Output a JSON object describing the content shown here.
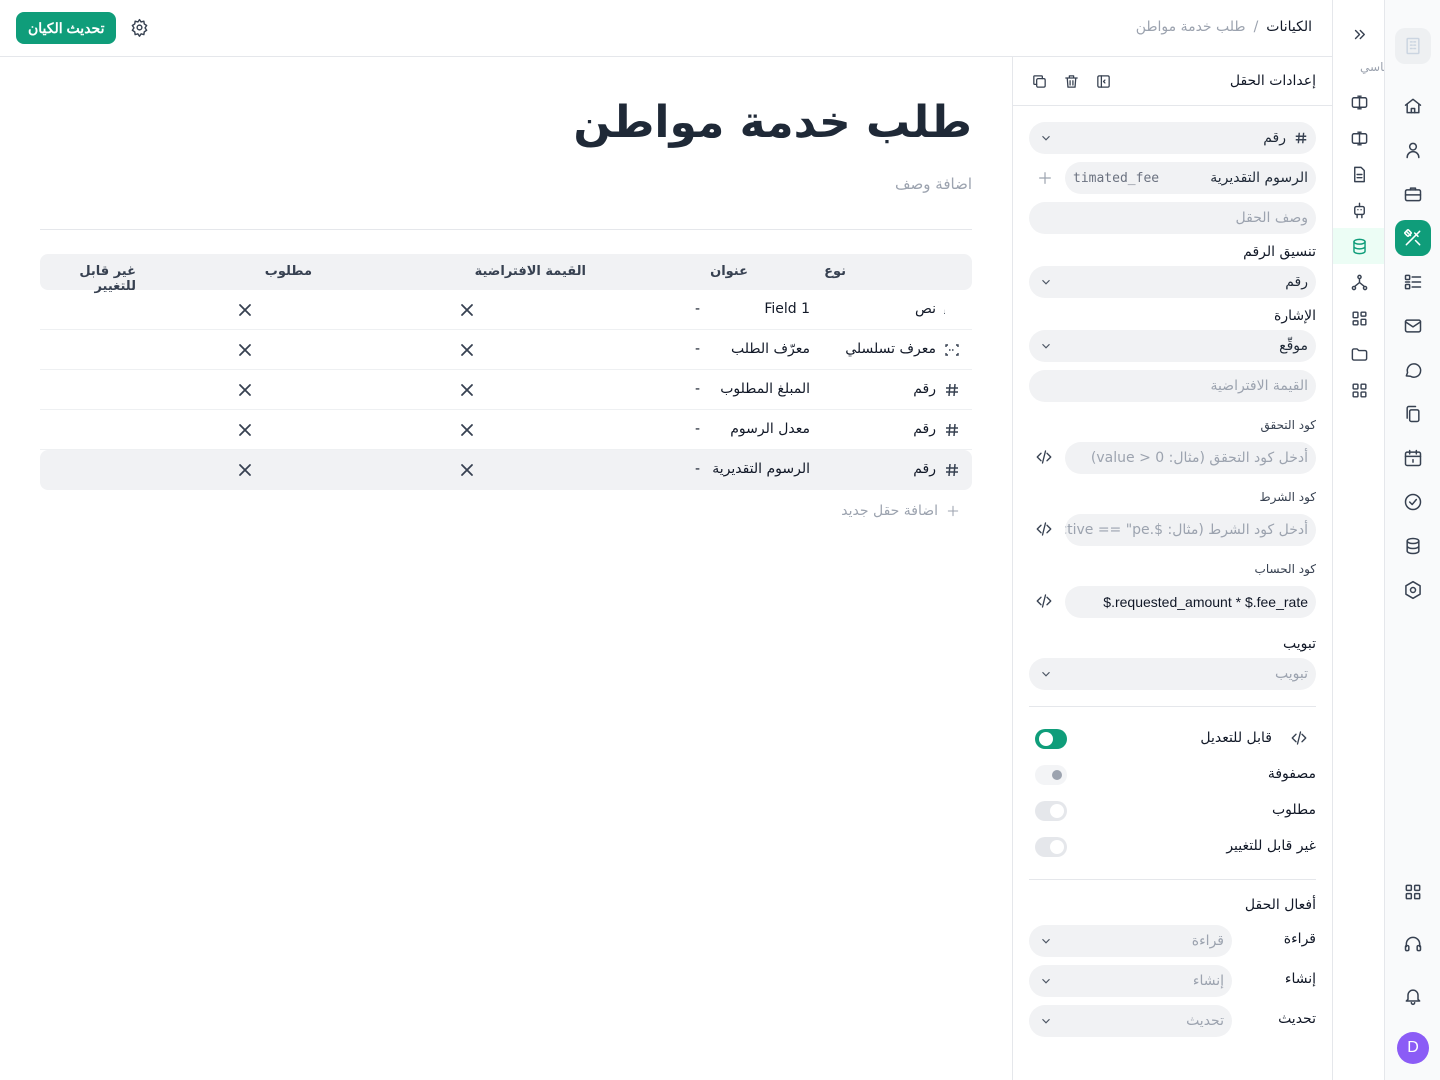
{
  "header": {
    "breadcrumb_root": "الكيانات",
    "breadcrumb_sep": "/",
    "breadcrumb_current": "طلب خدمة مواطن",
    "update_button": "تحديث الكيان"
  },
  "subnav": {
    "section_label": "الأساسي"
  },
  "rail": {
    "avatar_letter": "D",
    "accent_color": "#0f9d7a",
    "avatar_color": "#8b5cf6"
  },
  "main": {
    "title": "طلب خدمة مواطن",
    "description_placeholder": "اضافة وصف",
    "columns": [
      "نوع",
      "عنوان",
      "القيمة الافتراضية",
      "مطلوب",
      "غير قابل للتغيير"
    ],
    "rows": [
      {
        "type": "نص",
        "type_icon": "text-type-icon",
        "title": "Field 1",
        "default": "-"
      },
      {
        "type": "معرف تسلسلي",
        "type_icon": "sequence-id-icon",
        "title": "معرّف الطلب",
        "default": "-"
      },
      {
        "type": "رقم",
        "type_icon": "hash-icon",
        "title": "المبلغ المطلوب",
        "default": "-"
      },
      {
        "type": "رقم",
        "type_icon": "hash-icon",
        "title": "معدل الرسوم",
        "default": "-"
      },
      {
        "type": "رقم",
        "type_icon": "hash-icon",
        "title": "الرسوم التقديرية",
        "default": "-"
      }
    ],
    "add_field": "اضافة حقل جديد"
  },
  "panel": {
    "title": "إعدادات الحقل",
    "type_value": "رقم",
    "field_label": "الرسوم التقديرية",
    "field_key": "timated_fee",
    "description_placeholder": "وصف الحقل",
    "number_format_label": "تنسيق الرقم",
    "number_format_value": "رقم",
    "sign_label": "الإشارة",
    "sign_value": "موقّع",
    "default_placeholder": "القيمة الافتراضية",
    "validation_label": "كود التحقق",
    "validation_placeholder": "أدخل كود التحقق (مثال: value > 0)",
    "condition_label": "كود الشرط",
    "condition_placeholder": "أدخل كود الشرط (مثال: $.active == \"pe",
    "compute_label": "كود الحساب",
    "compute_value": "$.requested_amount * $.fee_rate",
    "tab_label": "تبويب",
    "tab_placeholder": "تبويب",
    "editable_label": "قابل للتعديل",
    "array_label": "مصفوفة",
    "required_label": "مطلوب",
    "immutable_label": "غير قابل للتغيير",
    "editable_on": true,
    "array_on": false,
    "required_on": false,
    "immutable_on": false,
    "actions_label": "أفعال الحقل",
    "read_label": "قراءة",
    "read_placeholder": "قراءة",
    "create_label": "إنشاء",
    "create_placeholder": "إنشاء",
    "update_label": "تحديث",
    "update_placeholder": "تحديث"
  }
}
